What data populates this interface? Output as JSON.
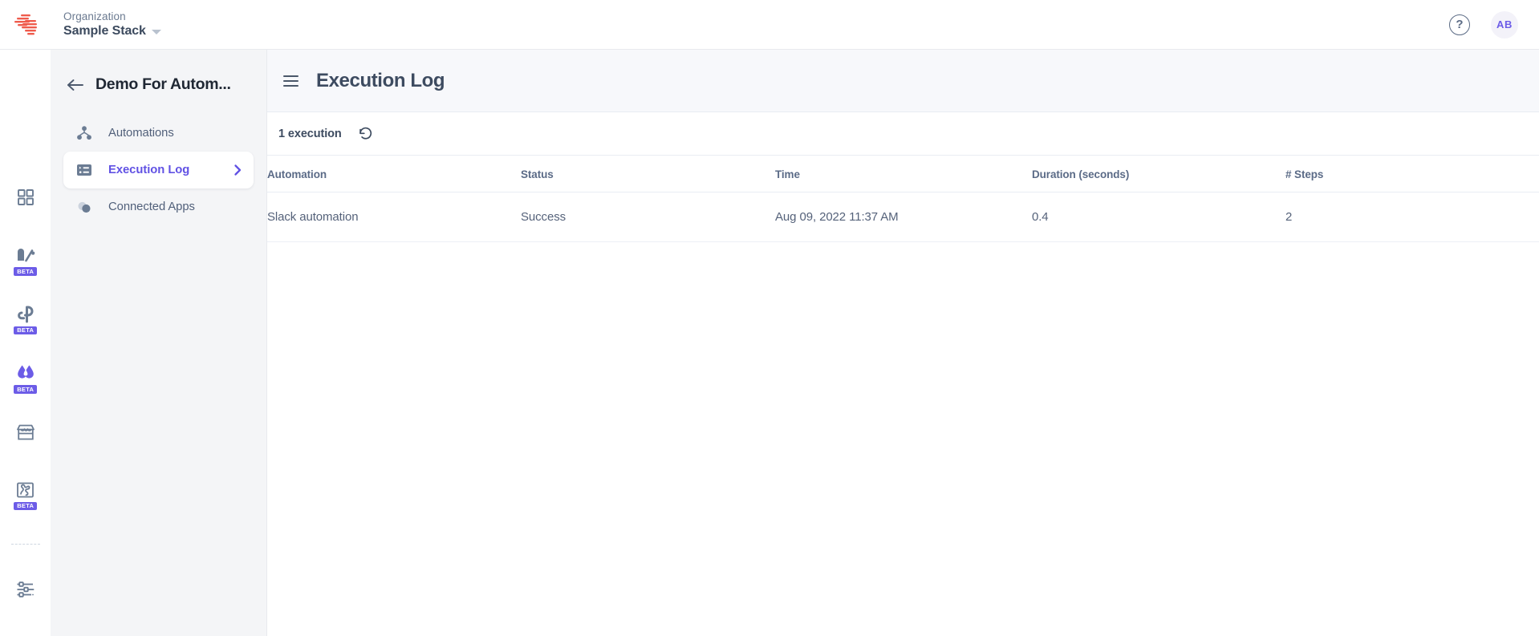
{
  "topbar": {
    "logo_icon": "red-stacked-bars-logo",
    "org_label": "Organization",
    "org_name": "Sample Stack",
    "org_caret_icon": "caret-down-icon",
    "help_icon_glyph": "?",
    "help_icon": "help-question-icon",
    "avatar_initials": "AB"
  },
  "rail": {
    "items": [
      {
        "icon": "grid-dashboard-icon",
        "beta": ""
      },
      {
        "icon": "analytics-chart-icon",
        "beta": "BETA"
      },
      {
        "icon": "pipeline-icon",
        "beta": "BETA"
      },
      {
        "icon": "droplets-icon",
        "beta": "BETA"
      },
      {
        "icon": "marketplace-store-icon",
        "beta": ""
      },
      {
        "icon": "puzzle-integration-icon",
        "beta": "BETA"
      },
      {
        "icon": "settings-sliders-icon",
        "beta": ""
      }
    ],
    "active_index": 3,
    "active_indicator_color": "#8f84e8"
  },
  "subnav": {
    "back_icon": "arrow-left-icon",
    "title": "Demo For Autom...",
    "items": [
      {
        "label": "Automations",
        "icon": "automations-node-icon",
        "active": false,
        "chevron": ""
      },
      {
        "label": "Execution Log",
        "icon": "execution-log-list-icon",
        "active": true,
        "chevron": "chevron-right-icon"
      },
      {
        "label": "Connected Apps",
        "icon": "connected-apps-circles-icon",
        "active": false,
        "chevron": ""
      }
    ]
  },
  "main": {
    "menu_icon": "hamburger-menu-icon",
    "title": "Execution Log",
    "toolbar": {
      "count_label": "1 execution",
      "refresh_icon": "refresh-rotate-left-icon"
    },
    "table": {
      "columns": [
        "Automation",
        "Status",
        "Time",
        "Duration (seconds)",
        "# Steps"
      ],
      "rows": [
        {
          "automation": "Slack automation",
          "status": "Success",
          "time": "Aug 09, 2022 11:37 AM",
          "duration": "0.4",
          "steps": "2"
        }
      ]
    }
  },
  "colors": {
    "accent_purple": "#6152e4",
    "beta_badge": "#6c5ce7",
    "logo_red": "#ef5b4c",
    "sidebar_bg": "#f4f5f7",
    "page_head_bg": "#f7f8fb"
  }
}
